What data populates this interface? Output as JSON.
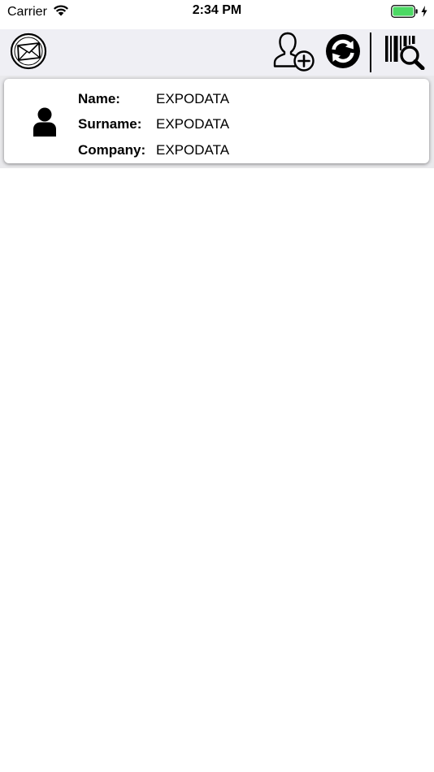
{
  "status_bar": {
    "carrier": "Carrier",
    "time": "2:34 PM",
    "battery_color": "#4cd964"
  },
  "toolbar": {
    "buttons": [
      {
        "icon": "mail-globe-icon"
      },
      {
        "icon": "add-user-icon"
      },
      {
        "icon": "sync-icon"
      },
      {
        "icon": "barcode-search-icon"
      }
    ]
  },
  "contacts": [
    {
      "name_label": "Name:",
      "name": "EXPODATA",
      "surname_label": "Surname:",
      "surname": "EXPODATA",
      "company_label": "Company:",
      "company": "EXPODATA"
    }
  ]
}
